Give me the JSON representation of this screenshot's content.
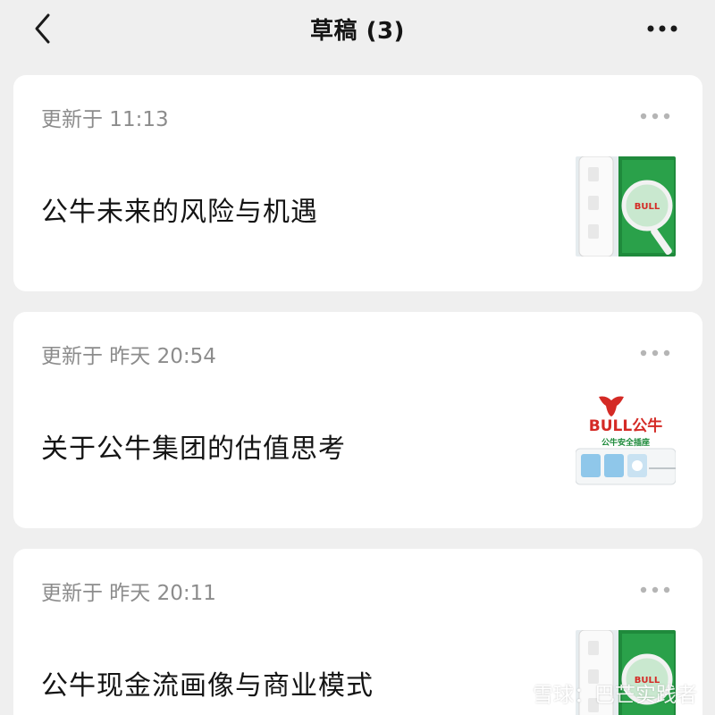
{
  "header": {
    "title": "草稿 (3)",
    "back_icon": "chevron-left-icon",
    "more_icon": "more-horizontal-icon"
  },
  "drafts": [
    {
      "time": "更新于 11:13",
      "title": "公牛未来的风险与机遇",
      "thumbnail": "bull-power-strip-magnifier-image"
    },
    {
      "time": "更新于 昨天 20:54",
      "title": "关于公牛集团的估值思考",
      "thumbnail": "bull-logo-power-strip-image",
      "logo_text": "BULL公牛",
      "logo_sub": "公牛安全插座"
    },
    {
      "time": "更新于 昨天 20:11",
      "title": "公牛现金流画像与商业模式",
      "thumbnail": "bull-power-strip-magnifier-image"
    }
  ],
  "watermark": {
    "text": "雪球：巴芒实践者",
    "icon": "snowball-logo-icon"
  },
  "colors": {
    "background": "#efefef",
    "card": "#ffffff",
    "muted_text": "#8c8c8c",
    "text": "#141414",
    "brand_red": "#d42a25",
    "brand_green": "#1d8a3a"
  }
}
